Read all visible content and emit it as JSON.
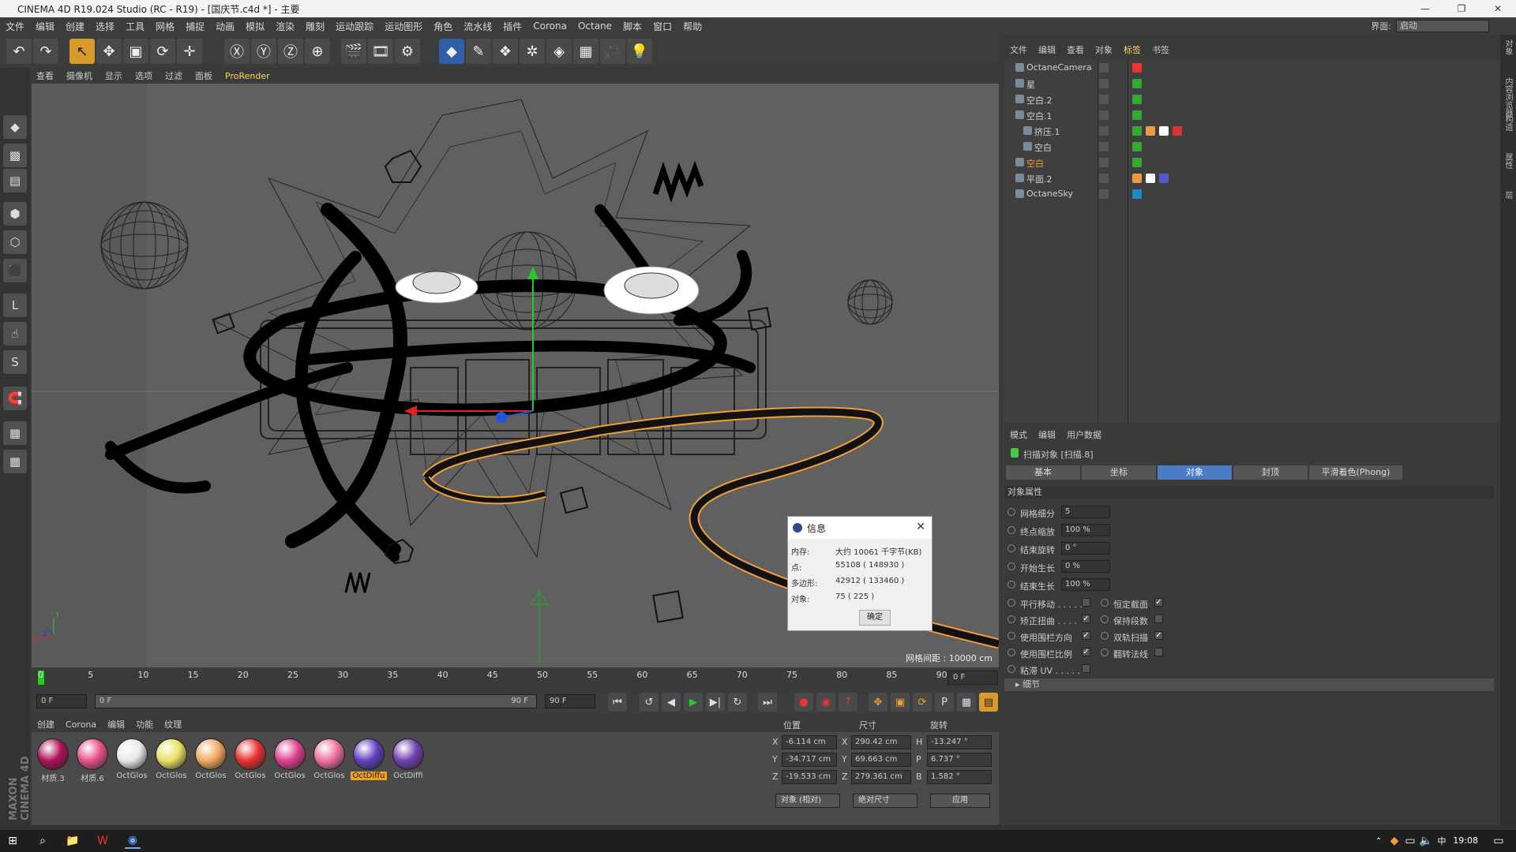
{
  "window": {
    "title": "CINEMA 4D R19.024 Studio (RC - R19) - [国庆节.c4d *] - 主要",
    "min": "—",
    "max": "❐",
    "close": "✕"
  },
  "menu": [
    "文件",
    "编辑",
    "创建",
    "选择",
    "工具",
    "网格",
    "捕捉",
    "动画",
    "模拟",
    "渲染",
    "雕刻",
    "运动跟踪",
    "运动图形",
    "角色",
    "流水线",
    "插件",
    "Corona",
    "Octane",
    "脚本",
    "窗口",
    "帮助"
  ],
  "layout": {
    "label": "界面:",
    "value": "启动"
  },
  "viewport_menu": [
    "查看",
    "摄像机",
    "显示",
    "选项",
    "过滤",
    "面板",
    "ProRender"
  ],
  "viewport": {
    "grid_label": "网格间距 : 10000 cm",
    "axis_y": "Y",
    "axis_x": "X",
    "axis_z": "Z"
  },
  "timeline": {
    "ticks": [
      "0",
      "5",
      "10",
      "15",
      "20",
      "25",
      "30",
      "35",
      "40",
      "45",
      "50",
      "55",
      "60",
      "65",
      "70",
      "75",
      "80",
      "85",
      "90"
    ],
    "current_frame": "0 F"
  },
  "transport": {
    "start": "0 F",
    "range_start": "0 F",
    "range_end": "90 F",
    "end": "90 F"
  },
  "material_menu": [
    "创建",
    "Corona",
    "编辑",
    "功能",
    "纹理"
  ],
  "materials": [
    {
      "name": "材质.3",
      "color": "#b0105a"
    },
    {
      "name": "材质.6",
      "color": "#e8508a"
    },
    {
      "name": "OctGlos",
      "color": "#e8e8e8"
    },
    {
      "name": "OctGlos",
      "color": "#e8e060"
    },
    {
      "name": "OctGlos",
      "color": "#f0a860"
    },
    {
      "name": "OctGlos",
      "color": "#e83030"
    },
    {
      "name": "OctGlos",
      "color": "#e04090"
    },
    {
      "name": "OctGlos",
      "color": "#f070a0"
    },
    {
      "name": "OctDiffu",
      "color": "#6040c0"
    },
    {
      "name": "OctDiffi",
      "color": "#7040b0"
    }
  ],
  "coords": {
    "headers": [
      "位置",
      "尺寸",
      "旋转"
    ],
    "rows": [
      {
        "ax1": "X",
        "pos": "-6.114 cm",
        "ax2": "X",
        "size": "290.42 cm",
        "ax3": "H",
        "rot": "-13.247 °"
      },
      {
        "ax1": "Y",
        "pos": "-34.717 cm",
        "ax2": "Y",
        "size": "69.663 cm",
        "ax3": "P",
        "rot": "6.737 °"
      },
      {
        "ax1": "Z",
        "pos": "-19.533 cm",
        "ax2": "Z",
        "size": "279.361 cm",
        "ax3": "B",
        "rot": "1.582 °"
      }
    ],
    "mode1": "对象 (相对)",
    "mode2": "绝对尺寸",
    "apply": "应用"
  },
  "object_manager": {
    "menu": [
      "文件",
      "编辑",
      "查看",
      "对象",
      "标签",
      "书签"
    ],
    "objects": [
      {
        "name": "OctaneCamera",
        "indent": 0,
        "orange": false
      },
      {
        "name": "星",
        "indent": 0,
        "orange": false
      },
      {
        "name": "空白.2",
        "indent": 0,
        "orange": false
      },
      {
        "name": "空白.1",
        "indent": 0,
        "orange": false
      },
      {
        "name": "挤压.1",
        "indent": 1,
        "orange": false
      },
      {
        "name": "空白",
        "indent": 1,
        "orange": false
      },
      {
        "name": "空白",
        "indent": 0,
        "orange": true
      },
      {
        "name": "平面.2",
        "indent": 0,
        "orange": false
      },
      {
        "name": "OctaneSky",
        "indent": 0,
        "orange": false
      }
    ]
  },
  "attributes": {
    "menu": [
      "模式",
      "编辑",
      "用户数据"
    ],
    "title": "扫描对象 [扫描.8]",
    "tabs": [
      "基本",
      "坐标",
      "对象",
      "封顶",
      "平滑着色(Phong)"
    ],
    "active_tab": "对象",
    "section": "对象属性",
    "props": [
      {
        "label": "网格细分",
        "value": "5"
      },
      {
        "label": "终点缩放",
        "value": "100 %"
      },
      {
        "label": "结束旋转",
        "value": "0 °"
      },
      {
        "label": "开始生长",
        "value": "0 %"
      },
      {
        "label": "结束生长",
        "value": "100 %"
      }
    ],
    "checks_left": [
      {
        "label": "平行移动 . . . . .",
        "checked": ""
      },
      {
        "label": "矫正扭曲 . . . .",
        "checked": "✓"
      },
      {
        "label": "使用围栏方向",
        "checked": "✓"
      },
      {
        "label": "使用围栏比例",
        "checked": "✓"
      },
      {
        "label": "粘滞 UV . . . . .",
        "checked": ""
      }
    ],
    "checks_right": [
      {
        "label": "恒定截面",
        "checked": "✓"
      },
      {
        "label": "保持段数",
        "checked": ""
      },
      {
        "label": "双轨扫描",
        "checked": "✓"
      },
      {
        "label": "翻转法线",
        "checked": ""
      }
    ],
    "detail": "▸ 细节"
  },
  "side_tabs": [
    "对象",
    "内容浏览器",
    "构造",
    "属性",
    "层"
  ],
  "info_dialog": {
    "title": "信息",
    "rows": [
      {
        "k": "内存:",
        "v": "大约 10061 千字节(KB)"
      },
      {
        "k": "点:",
        "v": "55108 ( 148930 )"
      },
      {
        "k": "多边形:",
        "v": "42912 ( 133460 )"
      },
      {
        "k": "对象:",
        "v": "75 ( 225 )"
      }
    ],
    "ok": "确定"
  },
  "brand": "MAXON CINEMA 4D",
  "taskbar": {
    "time": "19:08"
  }
}
